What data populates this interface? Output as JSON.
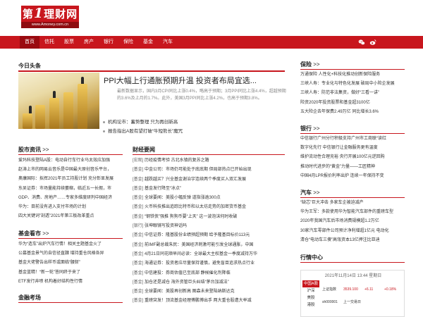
{
  "header": {
    "logo_prefix": "第",
    "logo_big": "1",
    "logo_suffix": "理财网",
    "logo_url": "www.Amoney.com.cn"
  },
  "nav": {
    "items": [
      "首页",
      "信托",
      "股票",
      "房产",
      "银行",
      "保险",
      "基金",
      "汽车"
    ],
    "icons": [
      "wechat-icon",
      "weibo-icon"
    ]
  },
  "headline": {
    "title": "今日头条",
    "news_title": "PPI大幅上行通胀预期升温 投资者布局宜选...",
    "news_desc": "最新数据显示，国内3月CPI同比上涨0.4%，略高于预期；3月PPI同比上涨4.4%，超越预期的3.6%及上月的1.7%。此外，美国3月PPI同比上涨4.2%，也高于预期3.8%。",
    "links": [
      "机构论市：蓄势整理 只为再创新高",
      "报告指出A股有望打破“牛短熊长”魔咒"
    ]
  },
  "stock_hot": {
    "title": "股市资讯",
    "arrow": ">>",
    "items": [
      "爱玛科技登陆A股：电动自行车行业马太效应加强",
      "赵涛上市的网易云音乐是中国最大原创音乐平台，",
      "奥康国际：拟挥2021年员工持股计划 充分彰显发展",
      "东吴证券：市场量能持续萎缩，临近五一长假，市",
      "GDP、消费、房地产……专家多维度研判中国经济",
      "华为：目前没有进入支付市场的计划",
      "四大关键词”剖透”2021年第三板改革重点"
    ]
  },
  "fund": {
    "title": "基金看市",
    "arrow": ">>",
    "items": [
      "华为“造车”出炉汽车行情！相关主题基金火了",
      "公募基金景气的自信径直蹿 增持重仓风格各异",
      "基金大佬警告出样币或面临“腰斩”",
      "基金蓝精！“新一轮”答同终于来了",
      "ETF发行井喷 机构着好结构性行情"
    ]
  },
  "exam": {
    "title": "金融考场"
  },
  "finance": {
    "title": "财经要闻",
    "items": [
      {
        "tag": "[宏观]",
        "text": "历经疫情考验 古北水镇的复苏之路"
      },
      {
        "tag": "[基金]",
        "text": "中金公司：市场仍可能处于底底期 但局部热点已开始出现"
      },
      {
        "tag": "[基金]",
        "text": "越跌越买？兴全基金谢治宇连续两个季度买入双汇发展"
      },
      {
        "tag": "[基金]",
        "text": "基金发行降至“冰点”"
      },
      {
        "tag": "[基金]",
        "text": "全球要闻：美股小幅反弹 道指涨逾300点"
      },
      {
        "tag": "[基金]",
        "text": "火币科技推出追踪比特币和以太坊走势的加密货币基金"
      },
      {
        "tag": "[基金]",
        "text": "“钢铁侠”强推 狗狗币要“上天” 这一波泡沫何时收破"
      },
      {
        "tag": "[银行]",
        "text": "张坤眼镜写投资神话吗"
      },
      {
        "tag": "[基金]",
        "text": "中信证券：隆基股份业绩预超预期 给予隆基目标价113元"
      },
      {
        "tag": "[基金]",
        "text": "前IMF副总裁朱民：美国经济刺激可能引发全球通胀，中国"
      },
      {
        "tag": "[基金]",
        "text": "4月21日同花顺早间必读：全球最大主权基金一季度减持万华"
      },
      {
        "tag": "[基金]",
        "text": "海通证券：投资者应尽量保持谨慎，避免盲目追求热点行业"
      },
      {
        "tag": "[基金]",
        "text": "中信建投：券商估值已至底部 静候催化剂降临"
      },
      {
        "tag": "[基金]",
        "text": "加仓还是减仓 海外资管巨头纠结“茅台加减法”"
      },
      {
        "tag": "[基金]",
        "text": "全球要闻：美股再创新高 图森未来登陆纳斯达克"
      },
      {
        "tag": "[基金]",
        "text": "重磅突发！顶流基金经理傅鹏博出手 两大重仓股遭大举减"
      }
    ]
  },
  "insurance": {
    "title": "保险",
    "arrow": ">>",
    "items": [
      "万通保险 人性化+科技化推动创新保险服务",
      "三峡人寿：专业化与特色化发展 破局中小险企发展",
      "三峡人寿：防范非法集资，做好“三看一讲”",
      "险资2020年投资股票和基金超3100亿",
      "五大险企去年保费2.49万亿 同比增长3.6%"
    ]
  },
  "bank": {
    "title": "银行",
    "arrow": ">>",
    "items": [
      "中信银行广州分行积极支持广州市工商联“读红",
      "数字化先行 中信银行让金融服务更有温度",
      "维护流动性合理充裕 央行开展100亿元逆回购",
      "推动时代进步的“黄金”力量——工匠精神",
      "中国4月LPR报价利率出炉 连续一年保持不变"
    ]
  },
  "car": {
    "title": "汽车",
    "arrow": ">>",
    "items": [
      "“缺芯”巨大冲击 多家车企被迫减产",
      "华为王军：多款使用华为智能汽车部件的重磅车型",
      "2020年我国汽车后市场消费规模超1.2万亿",
      "30家汽车零部件公司预计净利增超1亿元 电动化",
      "清仓“电动车三傻”高瓴资本13亿押注比亚迪"
    ]
  },
  "quotes": {
    "title": "行情中心",
    "time": "2021年11月14日 13:44 星期日",
    "tabs": [
      "中国A股",
      "沪深",
      "美股",
      "港股"
    ],
    "rows": [
      {
        "c1": "",
        "c2": "",
        "c3": "",
        "c4": ""
      },
      {
        "c1": "上证指数",
        "c2": "3539.100",
        "c3": "+6.11",
        "c4": "+0.18%"
      },
      {
        "c1": "",
        "c2": "",
        "c3": "",
        "c4": ""
      },
      {
        "c1": "sh000001",
        "c2": "上一交易日",
        "c3": "",
        "c4": ""
      }
    ]
  },
  "colors": {
    "brand_red": "#c8161d",
    "dark_red": "#9a0a10"
  }
}
